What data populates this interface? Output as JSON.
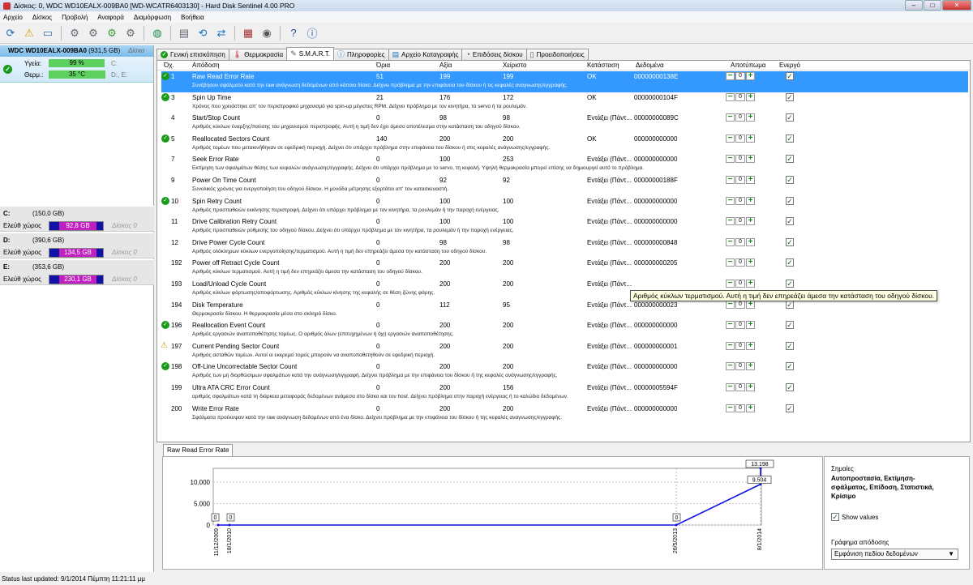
{
  "window": {
    "title": "Δίσκος: 0, WDC WD10EALX-009BA0 [WD-WCATR6403130] - Hard Disk Sentinel 4.00 PRO"
  },
  "menu": [
    "Αρχείο",
    "Δίσκος",
    "Προβολή",
    "Αναφορά",
    "Διαμόρφωση",
    "Βοήθεια"
  ],
  "disk": {
    "name": "WDC WD10EALX-009BA0",
    "size": "(931,5 GB)",
    "label": "Δίσκο",
    "health_label": "Υγεία:",
    "health_value": "99 %",
    "health_percent": 99,
    "temp_label": "Θερμ.:",
    "temp_value": "35 °C",
    "drives_line1": "C:",
    "drives_line2": "D:, E:"
  },
  "volumes": [
    {
      "name": "C:",
      "size": "(150,0 GB)",
      "free_label": "Ελεύθ χώρος",
      "free": "92,8 GB",
      "disk": "Δίσκος 0"
    },
    {
      "name": "D:",
      "size": "(390,6 GB)",
      "free_label": "Ελεύθ χώρος",
      "free": "134,5 GB",
      "disk": "Δίσκος 0"
    },
    {
      "name": "E:",
      "size": "(353,6 GB)",
      "free_label": "Ελεύθ χώρος",
      "free": "230,1 GB",
      "disk": "Δίσκος 0"
    }
  ],
  "tabs": [
    "Γενική επισκόπηση",
    "Θερμοκρασία",
    "S.M.A.R.T.",
    "Πληροφορίες",
    "Αρχείο Καταγραφής",
    "Επιδόσεις δίσκου",
    "Προειδοποιήσεις"
  ],
  "columns": [
    "Όχ.",
    "Απόδοση",
    "Όρια",
    "Αξία",
    "Χείριστο",
    "Κατάσταση",
    "Δεδομένα",
    "Αποτύπωμα",
    "Ενεργό"
  ],
  "smart_rows": [
    {
      "id": "1",
      "name": "Raw Read Error Rate",
      "thr": "51",
      "val": "199",
      "worst": "199",
      "status": "OK",
      "data": "00000000138E",
      "desc": "Συνέβησαν σφάλματα κατά την raw ανάγνωση δεδομένων από κάποιο δίσκο. Δείχνει πρόβλημα με την επιφάνεια του δίσκου ή τις κεφαλές αναγνωσης/εγγραφής.",
      "icon": "ok",
      "selected": true
    },
    {
      "id": "3",
      "name": "Spin Up Time",
      "thr": "21",
      "val": "176",
      "worst": "172",
      "status": "OK",
      "data": "00000000104F",
      "desc": "Χρόνος που χρειάστηκε απ' τον περιστροφικό μηχανισμό για spin-up μέγιστες RPM. Δείχνει πρόβλημα με τον κινητήρα, το servo ή τα ρουλεμάν.",
      "icon": "ok"
    },
    {
      "id": "4",
      "name": "Start/Stop Count",
      "thr": "0",
      "val": "98",
      "worst": "98",
      "status": "Εντάξει (Πάντ...",
      "data": "00000000089C",
      "desc": "Αριθμός κύκλων έναρξης/παύσης του μηχανισμού περιστροφής. Αυτή η τιμή δεν έχει άμεσο αποτέλεσμα στην κατάσταση του οδηγού δίσκου.",
      "icon": ""
    },
    {
      "id": "5",
      "name": "Reallocated Sectors Count",
      "thr": "140",
      "val": "200",
      "worst": "200",
      "status": "OK",
      "data": "000000000000",
      "desc": "Αριθμός τομέων που μετακινήθηκαν σε εφεδρική περιοχή. Δείχνει ότι υπάρχει πρόβλημα στην επιφάνεια του δίσκου ή στις κεφαλές ανάγνωσης/εγγραφής.",
      "icon": "ok"
    },
    {
      "id": "7",
      "name": "Seek Error Rate",
      "thr": "0",
      "val": "100",
      "worst": "253",
      "status": "Εντάξει (Πάντ...",
      "data": "000000000000",
      "desc": "Εκτίμηση των σφαλμάτων θέσης των κεφαλών ανάγνωσης/εγγραφής. Δείχνει ότι υπάρχει πρόβλημα με το servo, τη κεφαλή. Υψηλή θερμοκρασία μπορεί επίσης να δημιουργεί αυτό το πρόβλημα.",
      "icon": ""
    },
    {
      "id": "9",
      "name": "Power On Time Count",
      "thr": "0",
      "val": "92",
      "worst": "92",
      "status": "Εντάξει (Πάντ...",
      "data": "00000000188F",
      "desc": "Συνολικός χρόνος για ενεργοποίηση του οδηγού δίσκου. Η μονάδα μέτρησης εξαρτάται απ' τον κατασκευαστή.",
      "icon": ""
    },
    {
      "id": "10",
      "name": "Spin Retry Count",
      "thr": "0",
      "val": "100",
      "worst": "100",
      "status": "Εντάξει (Πάντ...",
      "data": "000000000000",
      "desc": "Αριθμός προσπαθειών εκκίνησης περιστροφή. Δείχνει ότι υπάρχει πρόβλημα με τον κινητήρα, τα ρουλεμάν ή την παροχή ενέργειας.",
      "icon": "ok"
    },
    {
      "id": "11",
      "name": "Drive Calibration Retry Count",
      "thr": "0",
      "val": "100",
      "worst": "100",
      "status": "Εντάξει (Πάντ...",
      "data": "000000000000",
      "desc": "Αριθμός προσπαθειών ρύθμισης του οδηγού δίσκου. Δείχνει ότι υπάρχει πρόβλημα με τον κινητήρα, τα ρουλεμάν ή την παροχή ενέργειας.",
      "icon": ""
    },
    {
      "id": "12",
      "name": "Drive Power Cycle Count",
      "thr": "0",
      "val": "98",
      "worst": "98",
      "status": "Εντάξει (Πάντ...",
      "data": "000000000848",
      "desc": "Αριθμός ολόκληρων κύκλων ενεργοποίησης/τερματισμού. Αυτή η τιμή δεν επηρεάζει άμεσα την κατάσταση του οδηγού δίσκου.",
      "icon": ""
    },
    {
      "id": "192",
      "name": "Power off Retract Cycle Count",
      "thr": "0",
      "val": "200",
      "worst": "200",
      "status": "Εντάξει (Πάντ...",
      "data": "000000000205",
      "desc": "Αριθμός κύκλων τερματισμού. Αυτή η τιμή δεν επηρεάζει άμεσα την κατάσταση του οδηγού δίσκου.",
      "icon": ""
    },
    {
      "id": "193",
      "name": "Load/Unload Cycle Count",
      "thr": "0",
      "val": "200",
      "worst": "200",
      "status": "Εντάξει (Πάντ...",
      "data": "",
      "desc": "Αριθμός κύκλων φόρτωσης/αποφόρτωσης. Αριθμός κύκλων κίνησης της κεφαλής σε θέση ζώνης φάρης.",
      "icon": ""
    },
    {
      "id": "194",
      "name": "Disk Temperature",
      "thr": "0",
      "val": "112",
      "worst": "95",
      "status": "Εντάξει (Πάντ...",
      "data": "000000000023",
      "desc": "Θερμοκρασία δίσκου. Η θερμοκρασία μέσα στο σκληρό δίσκο.",
      "icon": ""
    },
    {
      "id": "196",
      "name": "Reallocation Event Count",
      "thr": "0",
      "val": "200",
      "worst": "200",
      "status": "Εντάξει (Πάντ...",
      "data": "000000000000",
      "desc": "Αριθμός εργασιών αναποποθέτησης τομέως. Ο αριθμός όλων (επιτυχημένων ή όχι) εργασιών αναποποθέτησης.",
      "icon": "ok"
    },
    {
      "id": "197",
      "name": "Current Pending Sector Count",
      "thr": "0",
      "val": "200",
      "worst": "200",
      "status": "Εντάξει (Πάντ...",
      "data": "000000000001",
      "desc": "Αριθμός ασταθών τομέων. Αυτοί οι εκκρεμεί τομείς μπορούν να αναποποθετηθούν σε εφεδρική περιοχή.",
      "icon": "warn"
    },
    {
      "id": "198",
      "name": "Off-Line Uncorrectable Sector Count",
      "thr": "0",
      "val": "200",
      "worst": "200",
      "status": "Εντάξει (Πάντ...",
      "data": "000000000000",
      "desc": "Αριθμός των μη διορθώσιμων σφαλμάτων κατά την ανάγνωση/εγγραφή. Δείχνει πρόβλημα με την επιφάνεια του δίσκου ή της κεφαλές ανάγνωσης/εγγραφής.",
      "icon": "ok"
    },
    {
      "id": "199",
      "name": "Ultra ATA CRC Error Count",
      "thr": "0",
      "val": "200",
      "worst": "156",
      "status": "Εντάξει (Πάντ...",
      "data": "00000005594F",
      "desc": "αριθμός σφαλμάτων κατά τη διάρκεια μεταφοράς δεδομένων ανάμεσα στο δίσκο και τον host. Δείχνει πρόβλημα στην παροχή ενέργειας ή το καλώδιο δεδομένων.",
      "icon": ""
    },
    {
      "id": "200",
      "name": "Write Error Rate",
      "thr": "0",
      "val": "200",
      "worst": "200",
      "status": "Εντάξει (Πάντ...",
      "data": "000000000000",
      "desc": "Σφάλματα προέκυψαν κατά την raw ανάγνωση δεδομένων από ένα δίσκο. Δείχνει πρόβλημα με την επιφάνεια του δίσκου ή της κεφαλές αναγνωσης/εγγραφής.",
      "icon": ""
    }
  ],
  "tooltip": "Αριθμός κύκλων τερματισμού. Αυτή η τιμή δεν επηρεάζει άμεσα την κατάσταση του οδηγού δίσκου.",
  "graph": {
    "tab": "Raw Read Error Rate",
    "notes_label": "Σημαίες",
    "notes_value": "Αυτοπροστασία, Εκτίμηση-σφάλματος, Επίδοση, Στατιστικά, Κρίσιμο",
    "show_values": "Show values",
    "perf_label": "Γράφημα απόδοσης",
    "perf_select": "Εμφάνιση πεδίου δεδομένων"
  },
  "chart_data": {
    "type": "line",
    "x": [
      "11/12/2009",
      "18/1/2010",
      "26/5/2013",
      "8/1/2014",
      "8/1/2014"
    ],
    "values": [
      0,
      0,
      0,
      9504,
      13198
    ],
    "value_labels": [
      "0",
      "0",
      "0",
      "9.504",
      "13.198"
    ],
    "y_ticks": [
      "0",
      "5.000",
      "10.000"
    ],
    "ylim": [
      0,
      13198
    ]
  },
  "status": "Status last updated: 9/1/2014 Πέμπτη 11:21:11 μμ",
  "colors": {
    "selected": "#3399ff",
    "ok": "#1a9a1a",
    "line": "#1010e0"
  }
}
